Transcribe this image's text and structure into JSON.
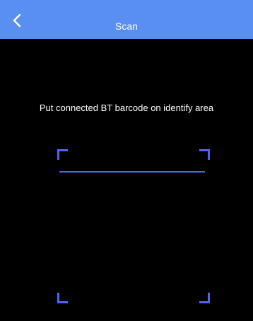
{
  "header": {
    "title": "Scan",
    "back_icon": "chevron-left-icon"
  },
  "scanner": {
    "instruction": "Put connected BT barcode on identify area"
  },
  "colors": {
    "header_background": "#5a8ff2",
    "screen_background": "#000000",
    "frame_accent": "#4a67f2",
    "text": "#ffffff"
  }
}
